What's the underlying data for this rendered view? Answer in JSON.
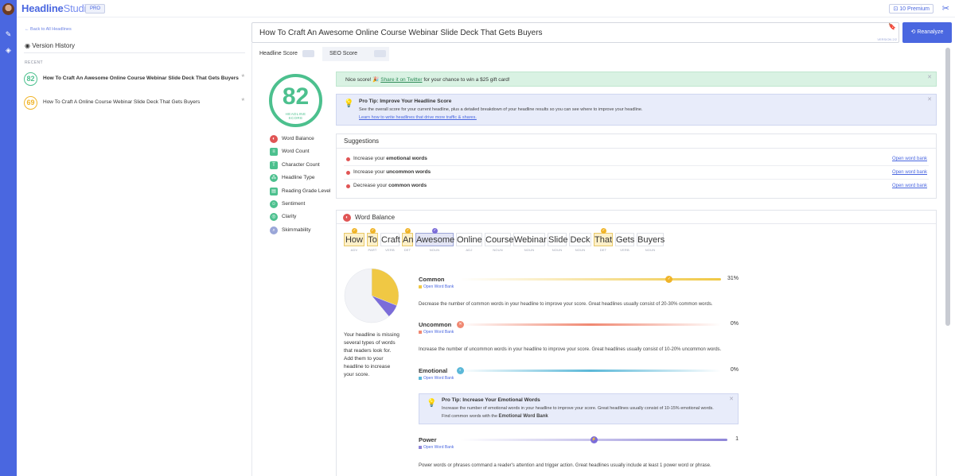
{
  "app": {
    "logo_bold": "Headline",
    "logo_light": "Studio",
    "pro_badge": "PRO",
    "premium": "10 Premium"
  },
  "sidebar": {
    "back_link": "Back to All Headlines",
    "version_history": "Version History",
    "recent_label": "RECENT",
    "history": [
      {
        "score": "82",
        "headline": "How To Craft An Awesome Online Course Webinar Slide Deck That Gets Buyers",
        "color": "#4cc08e"
      },
      {
        "score": "69",
        "headline": "How To Craft A Online Course Webinar Slide Deck That Gets Buyers",
        "color": "#f0b429"
      }
    ]
  },
  "editor": {
    "headline": "How To Craft An Awesome Online Course Webinar Slide Deck That Gets Buyers",
    "version": "VERSION 2/2",
    "reanalyze": "Reanalyze"
  },
  "tabs": [
    {
      "label": "Headline Score"
    },
    {
      "label": "SEO Score"
    }
  ],
  "score": {
    "value": "82",
    "label_line1": "HEADLINE",
    "label_line2": "SCORE",
    "color": "#4cc08e"
  },
  "criteria": [
    {
      "label": "Word Balance",
      "icon": "balance-icon",
      "color": "#e05555"
    },
    {
      "label": "Word Count",
      "icon": "word-count-icon",
      "color": "#4cc08e"
    },
    {
      "label": "Character Count",
      "icon": "character-count-icon",
      "color": "#4cc08e"
    },
    {
      "label": "Headline Type",
      "icon": "headline-type-icon",
      "color": "#4cc08e"
    },
    {
      "label": "Reading Grade Level",
      "icon": "reading-grade-icon",
      "color": "#4cc08e"
    },
    {
      "label": "Sentiment",
      "icon": "sentiment-icon",
      "color": "#4cc08e"
    },
    {
      "label": "Clarity",
      "icon": "clarity-icon",
      "color": "#4cc08e"
    },
    {
      "label": "Skimmability",
      "icon": "skimmability-icon",
      "color": "#9aa6d8"
    }
  ],
  "nice_score": {
    "prefix": "Nice score! 🎉",
    "link": "Share it on Twitter",
    "suffix": "for your chance to win a $25 gift card!"
  },
  "pro_tip": {
    "title": "Pro Tip: Improve Your Headline Score",
    "body": "See the overall score for your current headline, plus a detailed breakdown of your headline results so you can see where to improve your headline.",
    "link": "Learn how to write headlines that drive more traffic & shares."
  },
  "suggestions": {
    "heading": "Suggestions",
    "items": [
      {
        "pre": "Increase your",
        "bold": "emotional words",
        "link": "Open word bank"
      },
      {
        "pre": "Increase your",
        "bold": "uncommon words",
        "link": "Open word bank"
      },
      {
        "pre": "Decrease your",
        "bold": "common words",
        "link": "Open word bank"
      }
    ]
  },
  "word_balance": {
    "heading": "Word Balance",
    "words": [
      {
        "w": "How",
        "pos": "ADV",
        "style": "hl",
        "mark": "check"
      },
      {
        "w": "To",
        "pos": "PART",
        "style": "hl",
        "mark": "check"
      },
      {
        "w": "Craft",
        "pos": "VERB",
        "style": "pl",
        "mark": ""
      },
      {
        "w": "An",
        "pos": "DET",
        "style": "hl",
        "mark": "check"
      },
      {
        "w": "Awesome",
        "pos": "NOUN",
        "style": "hb",
        "mark": "power"
      },
      {
        "w": "Online",
        "pos": "ADJ",
        "style": "pl",
        "mark": ""
      },
      {
        "w": "Course",
        "pos": "NOUN",
        "style": "pl",
        "mark": ""
      },
      {
        "w": "Webinar",
        "pos": "NOUN",
        "style": "pl",
        "mark": ""
      },
      {
        "w": "Slide",
        "pos": "NOUN",
        "style": "pl",
        "mark": ""
      },
      {
        "w": "Deck",
        "pos": "NOUN",
        "style": "pl",
        "mark": ""
      },
      {
        "w": "That",
        "pos": "DET",
        "style": "hl",
        "mark": "check"
      },
      {
        "w": "Gets",
        "pos": "VERB",
        "style": "pl",
        "mark": ""
      },
      {
        "w": "Buyers",
        "pos": "NOUN",
        "style": "pl",
        "mark": ""
      }
    ],
    "pie": {
      "common_fraction": 0.31,
      "power_fraction": 0.08,
      "rest_fraction": 0.61
    },
    "pie_text": "Your headline is missing several types of words that readers look for. Add them to your headline to increase your score.",
    "metrics": [
      {
        "name": "Common",
        "open": "Open Word Bank",
        "pct": "31%",
        "value": 0.31,
        "color": "#f0c844",
        "desc": "Decrease the number of common words in your headline to improve your score. Great headlines usually consist of 20-30% common words."
      },
      {
        "name": "Uncommon",
        "open": "Open Word Bank",
        "pct": "0%",
        "value": 0.0,
        "color": "#f08872",
        "desc": "Increase the number of uncommon words in your headline to improve your score. Great headlines usually consist of 10-20% uncommon words."
      },
      {
        "name": "Emotional",
        "open": "Open Word Bank",
        "pct": "0%",
        "value": 0.0,
        "color": "#5bb8d8",
        "desc": ""
      },
      {
        "name": "Power",
        "open": "Open Word Bank",
        "pct": "1",
        "value": 0.5,
        "color": "#8f86d8",
        "desc": "Power words or phrases command a reader's attention and trigger action. Great headlines usually include at least 1 power word or phrase."
      }
    ],
    "emotional_tip": {
      "title": "Pro Tip: Increase Your Emotional Words",
      "line1": "Increase the number of emotional words in your headline to improve your score. Great headlines usually consist of 10-15% emotional words.",
      "line2_pre": "Find common words with the",
      "line2_bold": "Emotional Word Bank"
    }
  }
}
